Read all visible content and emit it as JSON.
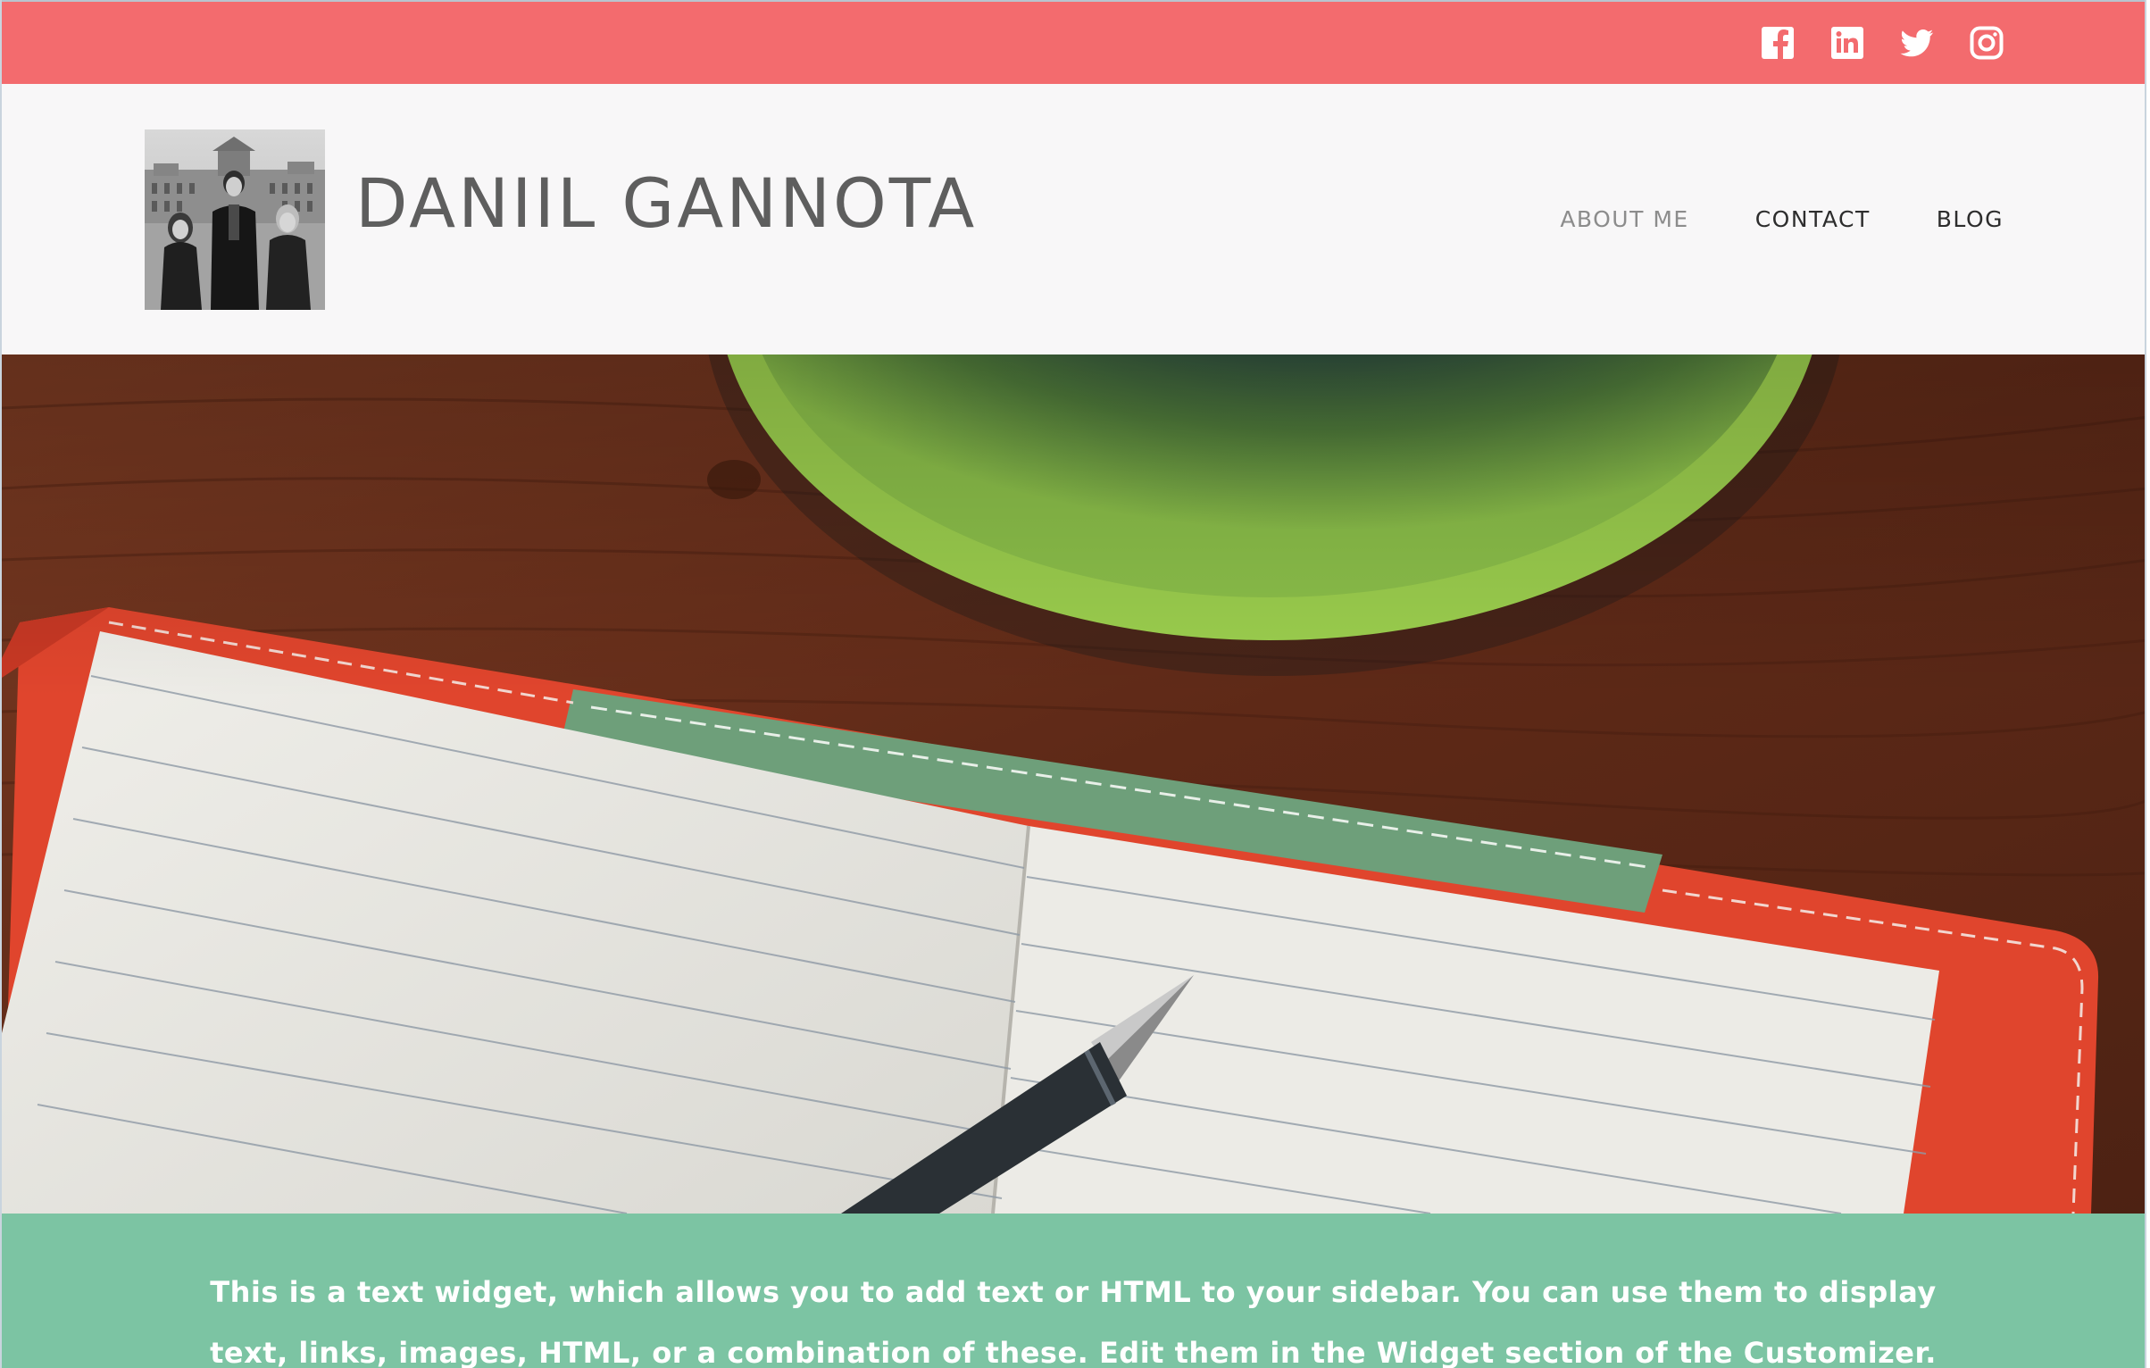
{
  "social": {
    "icons": [
      "facebook-icon",
      "linkedin-icon",
      "twitter-icon",
      "instagram-icon"
    ],
    "bar_color": "#f36b6e"
  },
  "header": {
    "site_title": "DANIIL GANNOTA",
    "logo_alt": "site-logo-photo"
  },
  "nav": {
    "items": [
      {
        "label": "ABOUT ME",
        "state": "muted"
      },
      {
        "label": "CONTACT",
        "state": "active"
      },
      {
        "label": "BLOG",
        "state": "active"
      }
    ]
  },
  "hero": {
    "image": "desk-notebook-pen-bowl"
  },
  "widget": {
    "text": "This is a text widget, which allows you to add text or HTML to your sidebar. You can use them to display text, links, images, HTML, or a combination of these. Edit them in the Widget section of the Customizer.",
    "background": "#7cc4a3"
  }
}
